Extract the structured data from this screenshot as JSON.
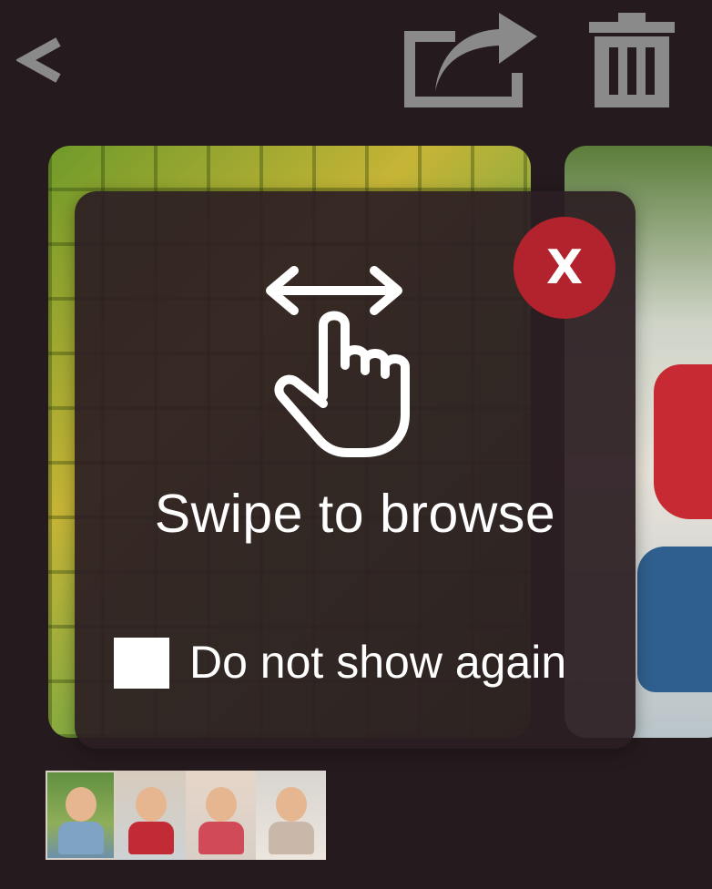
{
  "toolbar": {
    "back_icon": "chevron-left-icon",
    "share_icon": "share-icon",
    "delete_icon": "trash-icon"
  },
  "coach_mark": {
    "icon": "swipe-horizontal-gesture-icon",
    "close_label": "X",
    "message": "Swipe to browse",
    "checkbox_label": "Do not show again",
    "checkbox_checked": false
  },
  "thumbnails": {
    "count": 4,
    "selected_index": 0
  },
  "colors": {
    "background": "#251b1e",
    "close_button": "#b3232e",
    "toolbar_icon": "#8a8a8a",
    "text": "#ffffff"
  }
}
